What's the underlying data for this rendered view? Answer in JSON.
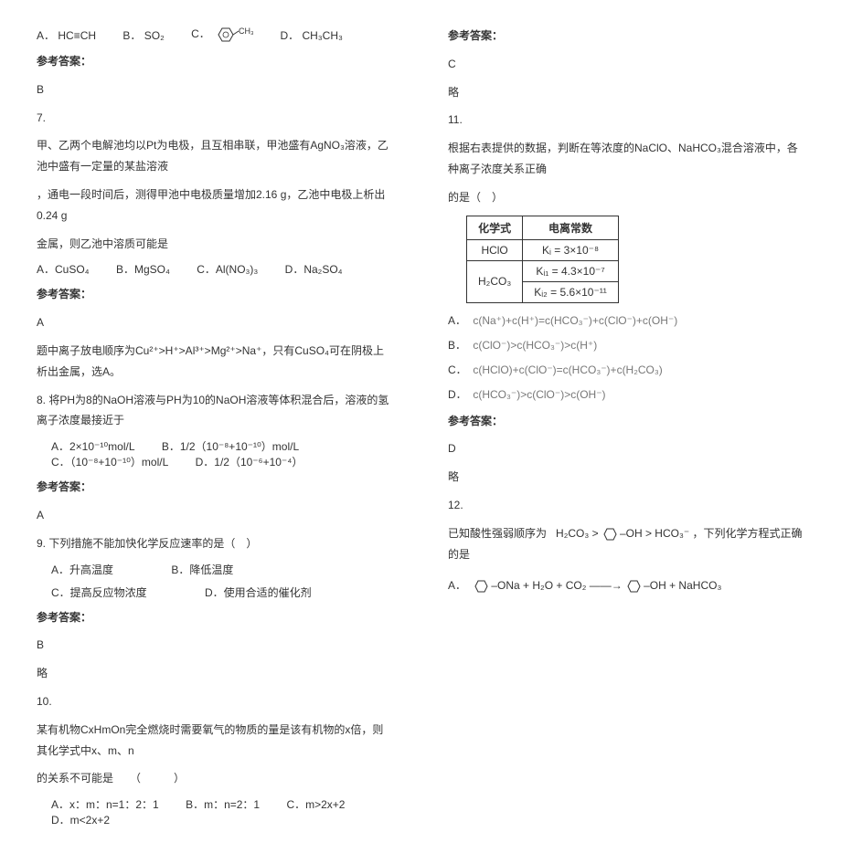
{
  "left": {
    "q6": {
      "optA_label": "A．",
      "optA_text": "HC≡CH",
      "optB_label": "B．",
      "optB_text": "SO₂",
      "optC_label": "C．",
      "optD_label": "D．",
      "optD_text": "CH₃CH₃",
      "answer_label": "参考答案：",
      "answer": "B"
    },
    "q7": {
      "num": "7.",
      "body1": "甲、乙两个电解池均以Pt为电极，且互相串联，甲池盛有AgNO₃溶液，乙池中盛有一定量的某盐溶液",
      "body2": "，通电一段时间后，测得甲池中电极质量增加2.16 g，乙池中电极上析出0.24 g",
      "body3": "金属，则乙池中溶质可能是",
      "optA": "A．CuSO₄",
      "optB": "B．MgSO₄",
      "optC": "C．Al(NO₃)₃",
      "optD": "D．Na₂SO₄",
      "answer_label": "参考答案：",
      "answer": "A",
      "explain": "题中离子放电顺序为Cu²⁺>H⁺>Al³⁺>Mg²⁺>Na⁺，只有CuSO₄可在阴极上析出金属，选A。"
    },
    "q8": {
      "num": "8.",
      "body": "将PH为8的NaOH溶液与PH为10的NaOH溶液等体积混合后，溶液的氢离子浓度最接近于",
      "optA": "A．2×10⁻¹⁰mol/L",
      "optB": "B．1/2（10⁻⁸+10⁻¹⁰）mol/L",
      "optC": "C．（10⁻⁸+10⁻¹⁰）mol/L",
      "optD": "D．1/2（10⁻⁶+10⁻⁴）",
      "answer_label": "参考答案：",
      "answer": "A"
    },
    "q9": {
      "num": "9.",
      "body": "下列措施不能加快化学反应速率的是（　）",
      "optA": "A．升高温度",
      "optB": "B．降低温度",
      "optC": "C．提高反应物浓度",
      "optD": "D．使用合适的催化剂",
      "answer_label": "参考答案：",
      "answer": "B",
      "explain": "略"
    },
    "q10": {
      "num": "10.",
      "body1": "某有机物CxHmOn完全燃烧时需要氧气的物质的量是该有机物的x倍，则其化学式中x、m、n",
      "body2": "的关系不可能是　　（　　　）",
      "optA": "A．x：m：n=1：2：1",
      "optB": "B．m：n=2：1",
      "optC": "C．m>2x+2",
      "optD": "D．m<2x+2"
    }
  },
  "right": {
    "q10ans": {
      "answer_label": "参考答案：",
      "answer": "C",
      "explain": "略"
    },
    "q11": {
      "num": "11.",
      "body1": "根据右表提供的数据，判断在等浓度的NaClO、NaHCO₃混合溶液中，各种离子浓度关系正确",
      "body2": "的是（　）",
      "th1": "化学式",
      "th2": "电离常数",
      "r1c1": "HClO",
      "r1c2": "Kᵢ = 3×10⁻⁸",
      "r2c1": "H₂CO₃",
      "r2c2a": "Kᵢ₁ = 4.3×10⁻⁷",
      "r2c2b": "Kᵢ₂ = 5.6×10⁻¹¹",
      "optA_label": "A．",
      "optA_text": "c(Na⁺)+c(H⁺)=c(HCO₃⁻)+c(ClO⁻)+c(OH⁻)",
      "optB_label": "B．",
      "optB_text": "c(ClO⁻)>c(HCO₃⁻)>c(H⁺)",
      "optC_label": "C．",
      "optC_text": "c(HClO)+c(ClO⁻)=c(HCO₃⁻)+c(H₂CO₃)",
      "optD_label": "D．",
      "optD_text": "c(HCO₃⁻)>c(ClO⁻)>c(OH⁻)",
      "answer_label": "参考答案：",
      "answer": "D",
      "explain": "略"
    },
    "q12": {
      "num": "12.",
      "body_pre": "已知酸性强弱顺序为",
      "body_mid": "H₂CO₃ >",
      "body_oh": "–OH",
      "body_gt": " > HCO₃⁻",
      "body_post": "，下列化学方程式正确的是",
      "optA_label": "A．",
      "optA_l1": "–ONa",
      "optA_plus": " + H₂O + CO₂ ——→ ",
      "optA_l2": "–OH",
      "optA_end": " + NaHCO₃"
    }
  }
}
